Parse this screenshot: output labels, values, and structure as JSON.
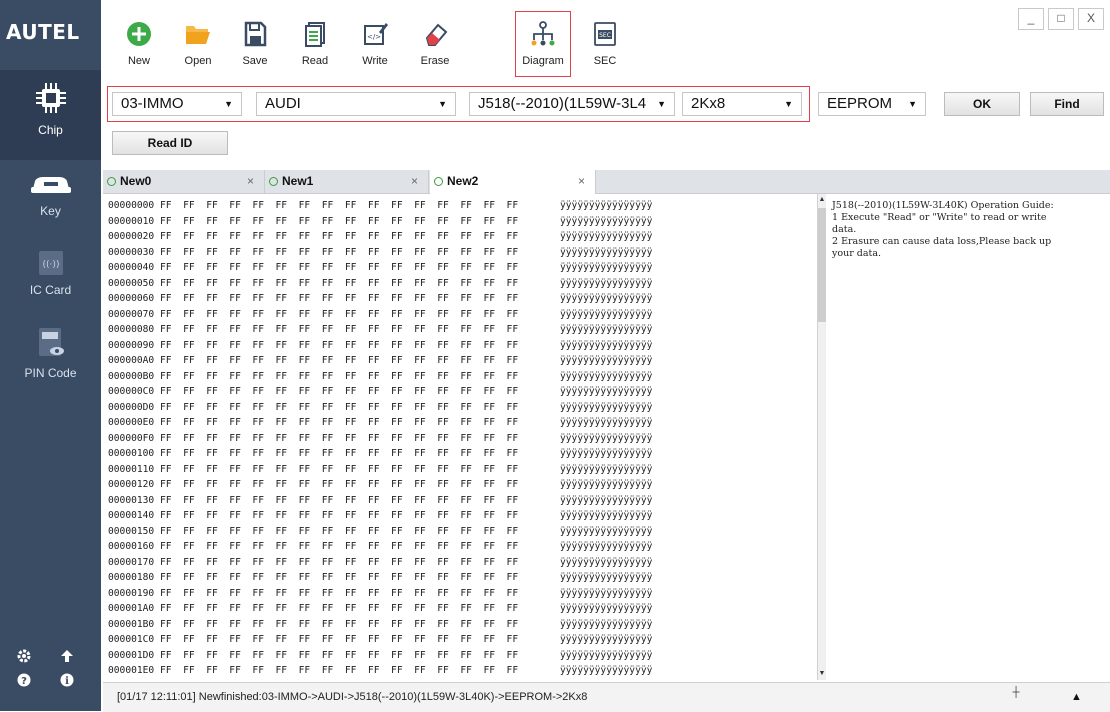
{
  "app": {
    "logo": "AUTEL"
  },
  "toolbar": {
    "new": "New",
    "open": "Open",
    "save": "Save",
    "read": "Read",
    "write": "Write",
    "erase": "Erase",
    "diagram": "Diagram",
    "sec": "SEC"
  },
  "window_controls": {
    "minimize": "_",
    "maximize": "□",
    "close": "X"
  },
  "sidebar": {
    "items": [
      {
        "label": "Chip",
        "icon": "chip-icon"
      },
      {
        "label": "Key",
        "icon": "car-key-icon"
      },
      {
        "label": "IC Card",
        "icon": "ic-card-icon"
      },
      {
        "label": "PIN Code",
        "icon": "pin-code-icon"
      }
    ],
    "bottom_icons": [
      "settings-icon",
      "upload-icon",
      "help-icon",
      "info-icon"
    ]
  },
  "selection": {
    "category": "03-IMMO",
    "brand": "AUDI",
    "model": "J518(--2010)(1L59W-3L4",
    "size": "2Kx8",
    "chip_type": "EEPROM",
    "ok_label": "OK",
    "find_label": "Find",
    "read_id_label": "Read ID"
  },
  "tabs": [
    {
      "label": "New0",
      "close": "×"
    },
    {
      "label": "New1",
      "close": "×"
    },
    {
      "label": "New2",
      "close": "×",
      "active": true
    }
  ],
  "hex": {
    "addresses": [
      "00000000",
      "00000010",
      "00000020",
      "00000030",
      "00000040",
      "00000050",
      "00000060",
      "00000070",
      "00000080",
      "00000090",
      "000000A0",
      "000000B0",
      "000000C0",
      "000000D0",
      "000000E0",
      "000000F0",
      "00000100",
      "00000110",
      "00000120",
      "00000130",
      "00000140",
      "00000150",
      "00000160",
      "00000170",
      "00000180",
      "00000190",
      "000001A0",
      "000001B0",
      "000001C0",
      "000001D0",
      "000001E0"
    ],
    "bytes": "FF  FF  FF  FF  FF  FF  FF  FF  FF  FF  FF  FF  FF  FF  FF  FF",
    "ascii": "ÿÿÿÿÿÿÿÿÿÿÿÿÿÿÿÿ"
  },
  "guide": {
    "lines": [
      "J518(--2010)(1L59W-3L40K) Operation Guide:",
      "1 Execute \"Read\" or \"Write\" to read or write",
      "data.",
      "2 Erasure can cause data loss,Please back up",
      "your data."
    ]
  },
  "status": {
    "text": "[01/17 12:11:01] Newfinished:03-IMMO->AUDI->J518(--2010)(1L59W-3L40K)->EEPROM->2Kx8",
    "up_arrow": "▲"
  },
  "colors": {
    "sidebar": "#3a4b64",
    "highlight_border": "#e0424a",
    "new_icon": "#3daa48",
    "open_icon": "#f1a21f",
    "tool_icon": "#3a4b64"
  }
}
